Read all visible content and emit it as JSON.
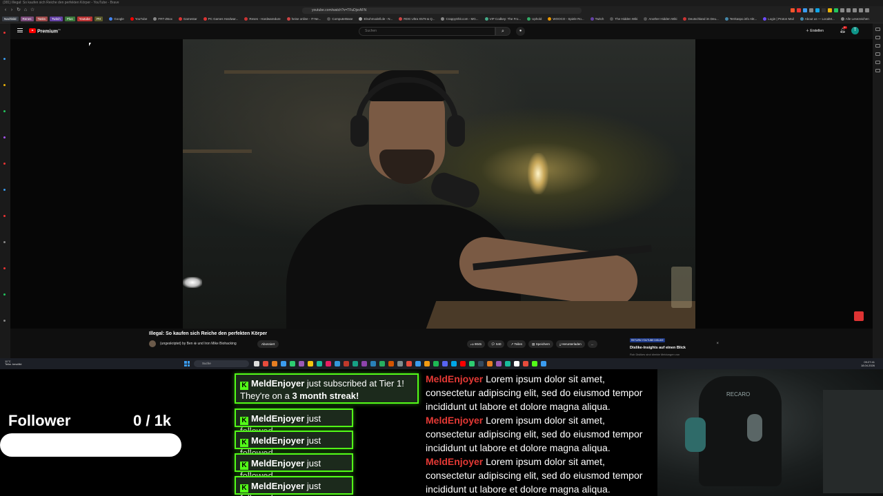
{
  "os": {
    "title": "(381) Illegal: So kaufen sich Reiche den perfekten Körper - YouTube - Brave"
  },
  "browser": {
    "url": "youtube.com/watch?v=TFuDjsrAFN",
    "bookmark_chips": [
      {
        "label": "Nachbild",
        "color": "#3a3f47"
      },
      {
        "label": "Renes",
        "color": "#7a4a7a"
      },
      {
        "label": "Tasks",
        "color": "#a04a4a"
      },
      {
        "label": "Twitch",
        "color": "#6441a5"
      },
      {
        "label": "Plus",
        "color": "#3b7a3b"
      },
      {
        "label": "Youtube",
        "color": "#b33"
      },
      {
        "label": "PH",
        "color": "#5a5a2a"
      }
    ],
    "bookmarks": [
      {
        "label": "Google",
        "color": "#4285f4"
      },
      {
        "label": "YouTube",
        "color": "#f00"
      },
      {
        "label": "FRT-ZBox",
        "color": "#888"
      },
      {
        "label": "Gamestar",
        "color": "#d33"
      },
      {
        "label": "PC Games Hardwar...",
        "color": "#d33"
      },
      {
        "label": "Reses - Hardwaredure",
        "color": "#c33"
      },
      {
        "label": "heise online - IT-Ne...",
        "color": "#c44"
      },
      {
        "label": "ComputerBase",
        "color": "#555"
      },
      {
        "label": "Elsohmodell.de - N...",
        "color": "#aaa"
      },
      {
        "label": "RDG Ultra X579 & Q...",
        "color": "#c44"
      },
      {
        "label": "CrappyShit.com - MG...",
        "color": "#888"
      },
      {
        "label": "VIP Codkey: The Fro...",
        "color": "#4a8"
      },
      {
        "label": "Uphold",
        "color": "#3a6"
      },
      {
        "label": "WOOCO - Spiele Ro...",
        "color": "#e90"
      },
      {
        "label": "Twitch",
        "color": "#6441a5"
      },
      {
        "label": "The Hidden Wiki",
        "color": "#555"
      },
      {
        "label": "Another Hidden Wiki",
        "color": "#555"
      },
      {
        "label": "Deutschland im Deu...",
        "color": "#c33"
      },
      {
        "label": "Terrkaspo.info Akt...",
        "color": "#48a"
      },
      {
        "label": "Login | Proton Mail",
        "color": "#6d4aff"
      },
      {
        "label": "About us — LocalM...",
        "color": "#48a"
      },
      {
        "label": "Alle Lesezeichen",
        "color": "#888"
      }
    ],
    "extension_colors": [
      "#fb542b",
      "#e33",
      "#3b9cf0",
      "#888",
      "#0ea5e9",
      "#333",
      "#eab308",
      "#22c55e",
      "#888",
      "#888",
      "#888",
      "#888",
      "#888"
    ]
  },
  "youtube": {
    "logo_text": "Premium",
    "logo_sup": "DE",
    "search_placeholder": "Suchen",
    "search_icon": "search-icon",
    "mic_icon": "mic-icon",
    "create_label": "Erstellen",
    "notification_count": "9+",
    "avatar_letter": "T",
    "video_title": "Illegal: So kaufen sich Reiche den perfekten Körper",
    "channel": "(ungeskriptet) by Ben ⊕ und Iron Mike Biohacking",
    "subscribe_label": "Abonniert",
    "likes": "9045",
    "comments": "540",
    "share_label": "Teilen",
    "save_label": "Speichern",
    "download_label": "Herunterladen",
    "more_label": "...",
    "ryd_tag": "RETURN YOUTUBE DISLIKE",
    "ryd_title": "Dislike-Insights auf einen Blick",
    "ryd_sub": "Rob Dislikes sind direkte Meldungen von"
  },
  "taskbar": {
    "weather_temp": "11°C",
    "weather_desc": "Teilw. bewölkt",
    "search_placeholder": "Suche",
    "time": "09:27:41",
    "date": "18.04.2026",
    "app_colors": [
      "#ddd",
      "#e74c3c",
      "#e67e22",
      "#3b9cf0",
      "#2ecc71",
      "#9b59b6",
      "#f1c40f",
      "#1abc9c",
      "#e91e63",
      "#3498db",
      "#c0392b",
      "#16a085",
      "#8e44ad",
      "#2980b9",
      "#27ae60",
      "#d35400",
      "#7f8c8d",
      "#e74c3c",
      "#3b9cf0",
      "#f39c12",
      "#1db954",
      "#5865f2",
      "#00a8e8",
      "#ff0000",
      "#2ecc71",
      "#34495e",
      "#e67e22",
      "#9b59b6",
      "#1abc9c",
      "#fff",
      "#e74c3c",
      "#53fc18",
      "#3b9cf0"
    ]
  },
  "overlay": {
    "follower_label": "Follower",
    "follower_count": "0 / 1k",
    "follower_progress": 0,
    "accent_color": "#53fc18",
    "sub_alert": {
      "user": "MeldEnjoyer",
      "text1": " just subscribed at Tier 1!",
      "text2": "They're on a ",
      "streak": "3 month streak!"
    },
    "follow_alerts": [
      {
        "user": "MeldEnjoyer",
        "text": " just followed"
      },
      {
        "user": "MeldEnjoyer",
        "text": " just followed"
      },
      {
        "user": "MeldEnjoyer",
        "text": " just followed"
      },
      {
        "user": "MeldEnjoyer",
        "text": " just followed"
      }
    ],
    "chat": [
      {
        "user": "MeldEnjoyer",
        "text": " Lorem ipsum dolor sit amet, consectetur adipiscing elit, sed do eiusmod tempor incididunt ut labore et dolore magna aliqua."
      },
      {
        "user": "MeldEnjoyer",
        "text": " Lorem ipsum dolor sit amet, consectetur adipiscing elit, sed do eiusmod tempor incididunt ut labore et dolore magna aliqua."
      },
      {
        "user": "MeldEnjoyer",
        "text": " Lorem ipsum dolor sit amet, consectetur adipiscing elit, sed do eiusmod tempor incididunt ut labore et dolore magna aliqua."
      }
    ],
    "cam_chair_brand": "RECARO"
  }
}
